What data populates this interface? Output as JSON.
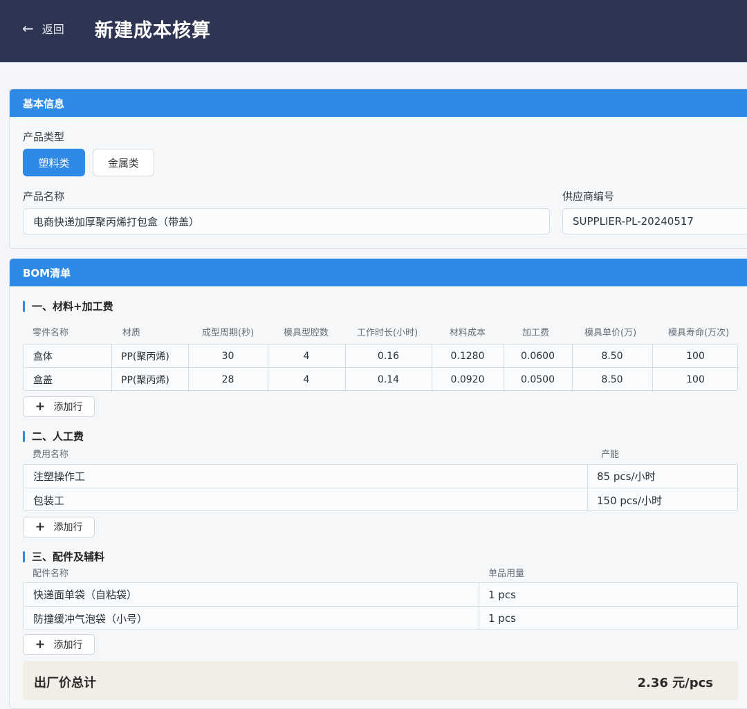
{
  "header": {
    "back_label": "返回",
    "title": "新建成本核算"
  },
  "basic": {
    "section_title": "基本信息",
    "product_type_label": "产品类型",
    "types": [
      "塑料类",
      "金属类"
    ],
    "selected_type": "塑料类",
    "product_name_label": "产品名称",
    "product_name_value": "电商快递加厚聚丙烯打包盒（带盖）",
    "supplier_label": "供应商编号",
    "supplier_value": "SUPPLIER-PL-20240517"
  },
  "bom": {
    "section_title": "BOM清单",
    "materials": {
      "title": "一、材料+加工费",
      "columns": [
        "零件名称",
        "材质",
        "成型周期(秒)",
        "模具型腔数",
        "工作时长(小时)",
        "材料成本",
        "加工费",
        "模具单价(万)",
        "模具寿命(万次)"
      ],
      "rows": [
        [
          "盒体",
          "PP(聚丙烯)",
          "30",
          "4",
          "0.16",
          "0.1280",
          "0.0600",
          "8.50",
          "100"
        ],
        [
          "盒盖",
          "PP(聚丙烯)",
          "28",
          "4",
          "0.14",
          "0.0920",
          "0.0500",
          "8.50",
          "100"
        ]
      ],
      "add_label": "添加行"
    },
    "labor": {
      "title": "二、人工费",
      "columns": [
        "费用名称",
        "产能"
      ],
      "rows": [
        [
          "注塑操作工",
          "85 pcs/小时"
        ],
        [
          "包装工",
          "150 pcs/小时"
        ]
      ],
      "add_label": "添加行"
    },
    "accessories": {
      "title": "三、配件及辅料",
      "columns": [
        "配件名称",
        "单品用量"
      ],
      "rows": [
        [
          "快递面单袋（自粘袋）",
          "1 pcs"
        ],
        [
          "防撞缓冲气泡袋（小号）",
          "1 pcs"
        ]
      ],
      "add_label": "添加行"
    },
    "total_label": "出厂价总计",
    "total_value": "2.36 元/pcs"
  }
}
